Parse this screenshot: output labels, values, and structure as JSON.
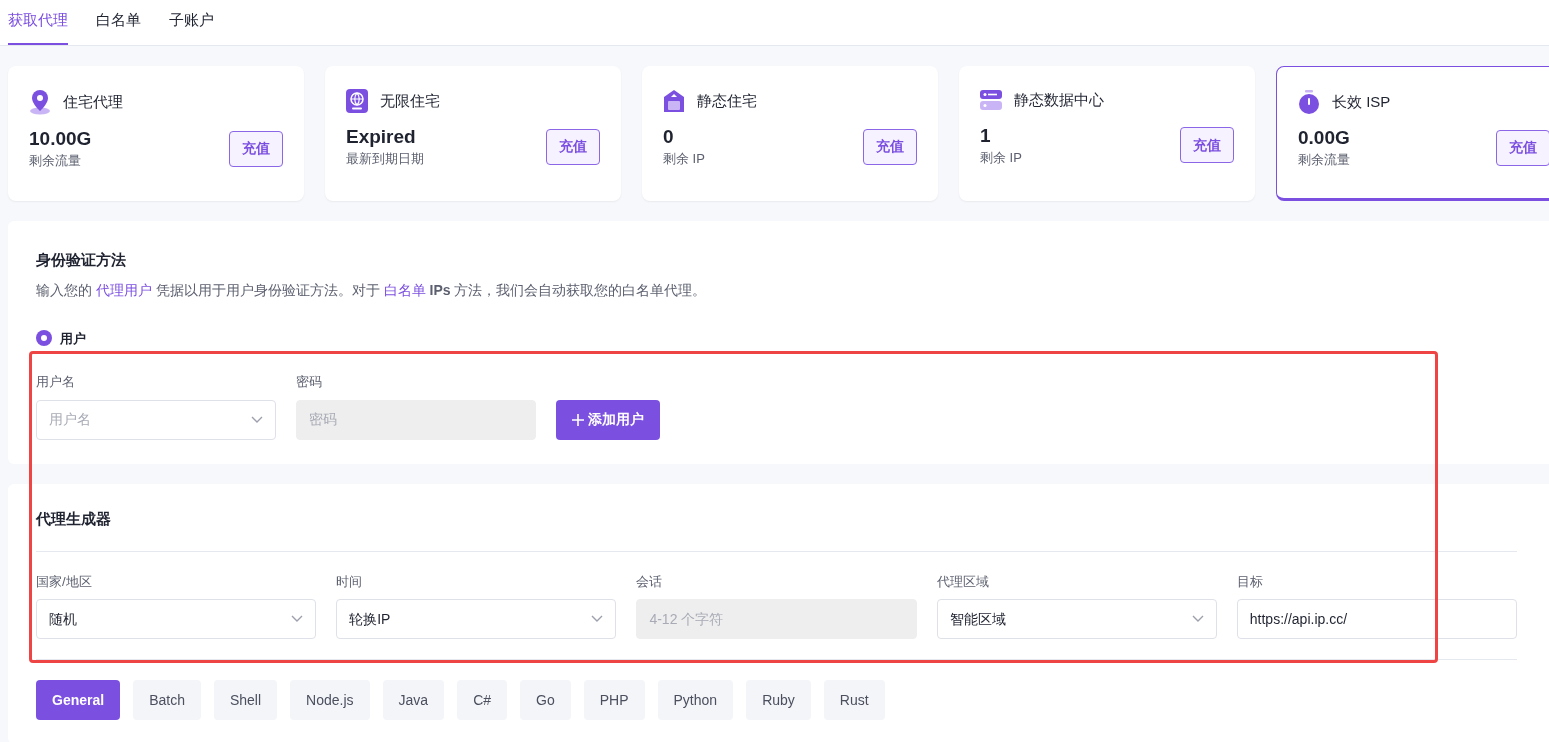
{
  "tabs": [
    {
      "label": "获取代理",
      "selected": true
    },
    {
      "label": "白名单",
      "selected": false
    },
    {
      "label": "子账户",
      "selected": false
    }
  ],
  "cards": [
    {
      "title": "住宅代理",
      "value": "10.00G",
      "caption": "剩余流量",
      "button": "充值",
      "selected": false
    },
    {
      "title": "无限住宅",
      "value": "Expired",
      "caption": "最新到期日期",
      "button": "充值",
      "selected": false
    },
    {
      "title": "静态住宅",
      "value": "0",
      "caption": "剩余 IP",
      "button": "充值",
      "selected": false
    },
    {
      "title": "静态数据中心",
      "value": "1",
      "caption": "剩余 IP",
      "button": "充值",
      "selected": false
    },
    {
      "title": "长效 ISP",
      "value": "0.00G",
      "caption": "剩余流量",
      "button": "充值",
      "selected": true
    }
  ],
  "auth": {
    "title": "身份验证方法",
    "description": [
      {
        "kind": "text",
        "text": "输入您的 "
      },
      {
        "kind": "link",
        "text": "代理用户"
      },
      {
        "kind": "text",
        "text": " 凭据以用于用户身份验证方法。对于 "
      },
      {
        "kind": "link",
        "text": "白名单"
      },
      {
        "kind": "text",
        "text": " **IPs** 方法，我们会自动获取您的白名单代理。"
      }
    ],
    "radios": [
      {
        "label": "用户",
        "selected": true
      }
    ],
    "fields": [
      {
        "kind": "select",
        "label": "用户名",
        "placeholder": "用户名"
      },
      {
        "kind": "disabled",
        "label": "密码",
        "placeholder": "密码"
      }
    ],
    "add_button": "添加用户"
  },
  "generator": {
    "title": "代理生成器",
    "fields": [
      {
        "kind": "select",
        "label": "国家/地区",
        "value": "随机"
      },
      {
        "kind": "select",
        "label": "时间",
        "value": "轮换IP"
      },
      {
        "kind": "disabled",
        "label": "会话",
        "placeholder": "4-12 个字符"
      },
      {
        "kind": "select",
        "label": "代理区域",
        "value": "智能区域"
      },
      {
        "kind": "input",
        "label": "目标",
        "value": "https://api.ip.cc/"
      }
    ],
    "code_tabs": [
      {
        "label": "General",
        "selected": true
      },
      {
        "label": "Batch",
        "selected": false
      },
      {
        "label": "Shell",
        "selected": false
      },
      {
        "label": "Node.js",
        "selected": false
      },
      {
        "label": "Java",
        "selected": false
      },
      {
        "label": "C#",
        "selected": false
      },
      {
        "label": "Go",
        "selected": false
      },
      {
        "label": "PHP",
        "selected": false
      },
      {
        "label": "Python",
        "selected": false
      },
      {
        "label": "Ruby",
        "selected": false
      },
      {
        "label": "Rust",
        "selected": false
      }
    ]
  }
}
